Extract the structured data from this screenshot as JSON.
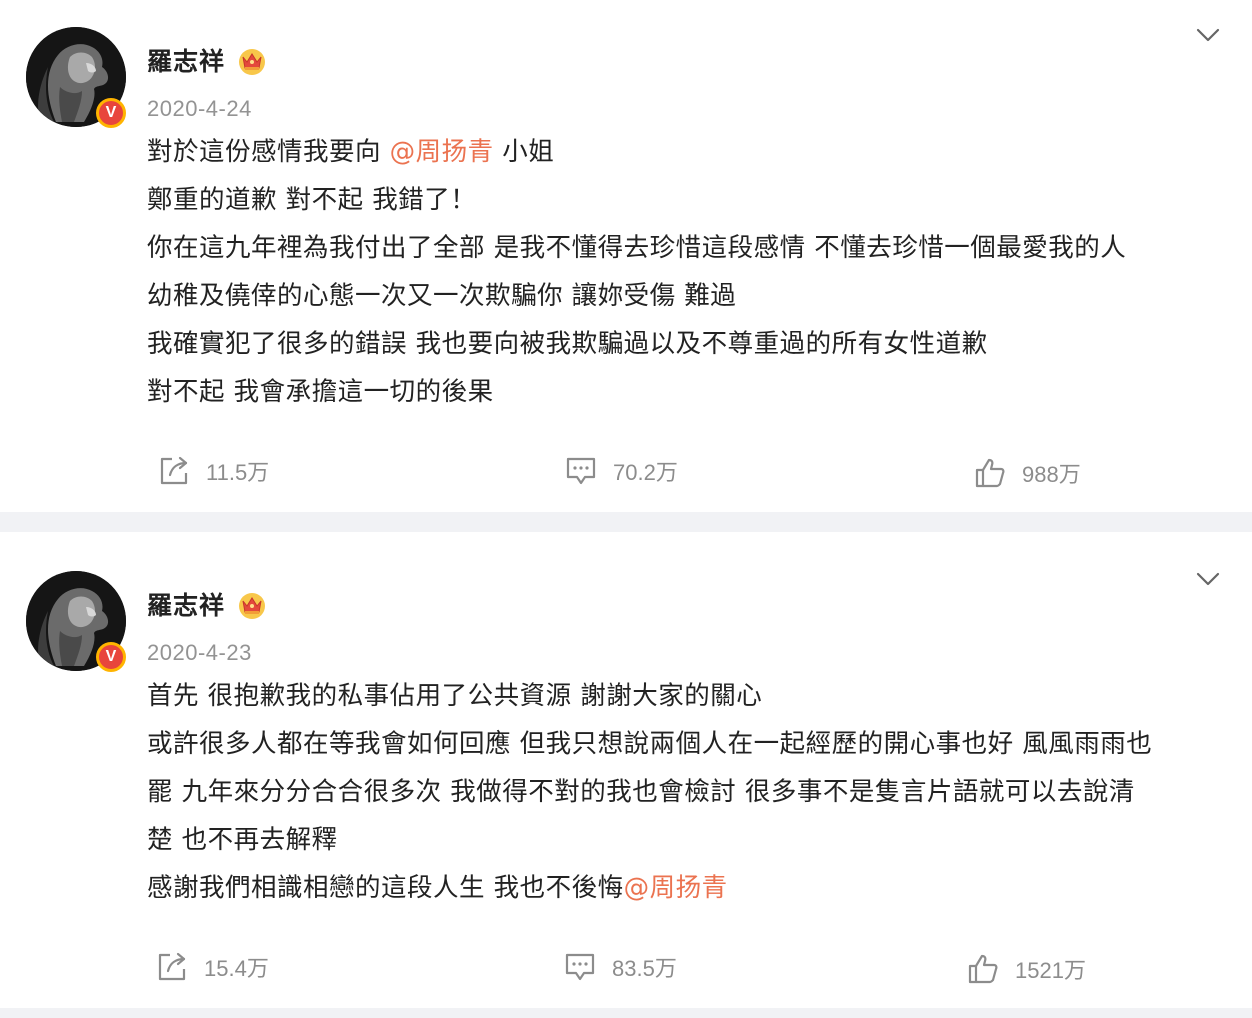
{
  "colors": {
    "mention": "#eb7350",
    "badge": "#e8453c",
    "separator": "#f1f2f5"
  },
  "posts": [
    {
      "author": "羅志祥",
      "verified_badge": "V",
      "crown_icon": "crown-icon",
      "date": "2020-4-24",
      "content": {
        "l1_pre": "對於這份感情我要向 ",
        "l1_mention": "@周扬青",
        "l1_post": " 小姐",
        "l2": "鄭重的道歉 對不起 我錯了！",
        "l3": "你在這九年裡為我付出了全部 是我不懂得去珍惜這段感情 不懂去珍惜一個最愛我的人",
        "l4": "幼稚及僥倖的心態一次又一次欺騙你 讓妳受傷 難過",
        "l5": "我確實犯了很多的錯誤 我也要向被我欺騙過以及不尊重過的所有女性道歉",
        "l6": "對不起   我會承擔這一切的後果"
      },
      "reposts": "11.5万",
      "comments": "70.2万",
      "likes": "988万"
    },
    {
      "author": "羅志祥",
      "verified_badge": "V",
      "crown_icon": "crown-icon",
      "date": "2020-4-23",
      "content": {
        "l1": "首先 很抱歉我的私事佔用了公共資源 謝謝大家的關心",
        "l2": "或許很多人都在等我會如何回應 但我只想說兩個人在一起經歷的開心事也好 風風雨雨也",
        "l3": "罷 九年來分分合合很多次 我做得不對的我也會檢討 很多事不是隻言片語就可以去說清",
        "l4": "楚 也不再去解釋",
        "l5_pre": "感謝我們相識相戀的這段人生 我也不後悔",
        "l5_mention": "@周扬青"
      },
      "reposts": "15.4万",
      "comments": "83.5万",
      "likes": "1521万"
    }
  ]
}
